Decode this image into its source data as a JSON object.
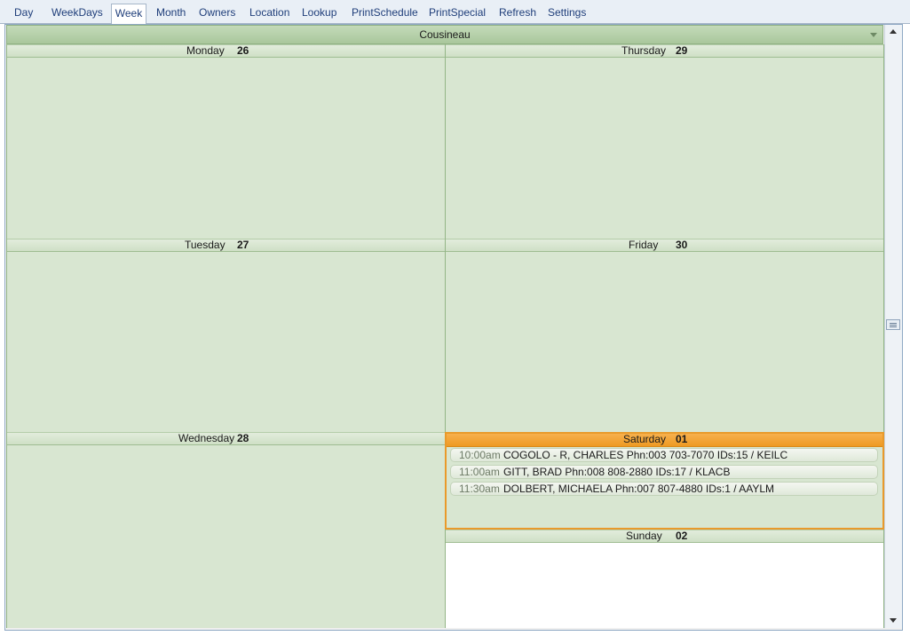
{
  "menu": [
    "Day",
    "WeekDays",
    "Week",
    "Month",
    "Owners",
    "Location",
    "Lookup",
    "PrintSchedule",
    "PrintSpecial",
    "Refresh",
    "Settings"
  ],
  "active_menu": "Week",
  "owner": {
    "name": "Cousineau",
    "dropdown_icon": "chevron-down-icon"
  },
  "days": {
    "monday": {
      "name": "Monday",
      "num": "26"
    },
    "tuesday": {
      "name": "Tuesday",
      "num": "27"
    },
    "wednesday": {
      "name": "Wednesday",
      "num": "28"
    },
    "thursday": {
      "name": "Thursday",
      "num": "29"
    },
    "friday": {
      "name": "Friday",
      "num": "30"
    },
    "saturday": {
      "name": "Saturday",
      "num": "01"
    },
    "sunday": {
      "name": "Sunday",
      "num": "02"
    }
  },
  "appointments": [
    {
      "time": "10:00am",
      "text": "COGOLO - R, CHARLES Phn:003 703-7070  IDs:15 / KEILC"
    },
    {
      "time": "11:00am",
      "text": "GITT, BRAD Phn:008 808-2880  IDs:17 / KLACB"
    },
    {
      "time": "11:30am",
      "text": "DOLBERT, MICHAELA Phn:007 807-4880  IDs:1 / AAYLM"
    }
  ],
  "colors": {
    "day_bg": "#d8e6d1",
    "selected_border": "#e99a2b",
    "selected_header": "#f0a030",
    "menu_text": "#1f3e7a"
  }
}
